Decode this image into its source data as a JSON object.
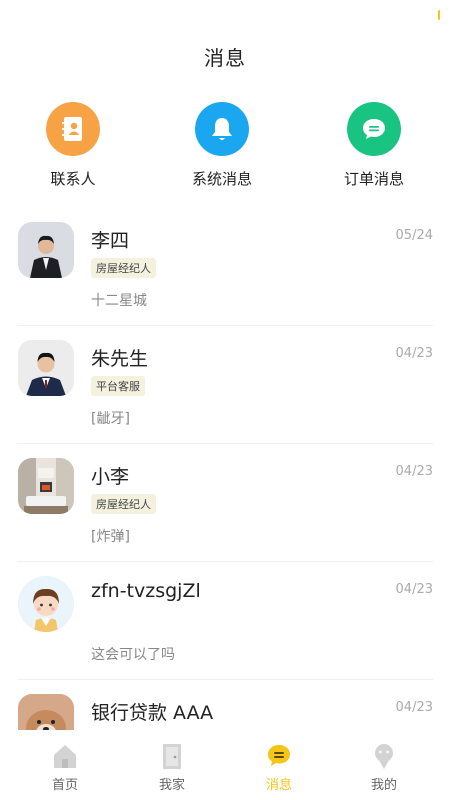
{
  "header": {
    "title": "消息"
  },
  "quick_actions": [
    {
      "label": "联系人",
      "icon": "contacts-book-icon",
      "color": "#F7A245"
    },
    {
      "label": "系统消息",
      "icon": "bell-icon",
      "color": "#1AA7F0"
    },
    {
      "label": "订单消息",
      "icon": "chat-bubble-icon",
      "color": "#19C483"
    }
  ],
  "messages": [
    {
      "name": "李四",
      "date": "05/24",
      "badge": "房屋经纪人",
      "preview": "十二星城"
    },
    {
      "name": "朱先生",
      "date": "04/23",
      "badge": "平台客服",
      "preview": "[龇牙]"
    },
    {
      "name": "小李",
      "date": "04/23",
      "badge": "房屋经纪人",
      "preview": "[炸弹]"
    },
    {
      "name": "zfn-tvzsgjZl",
      "date": "04/23",
      "badge": "",
      "preview": "这会可以了吗"
    },
    {
      "name": "银行贷款 AAA",
      "date": "04/23",
      "badge": "",
      "preview": ""
    }
  ],
  "tabbar": {
    "items": [
      {
        "label": "首页",
        "icon": "house-icon",
        "active": false
      },
      {
        "label": "我家",
        "icon": "door-icon",
        "active": false
      },
      {
        "label": "消息",
        "icon": "message-icon",
        "active": true
      },
      {
        "label": "我的",
        "icon": "person-icon",
        "active": false
      }
    ]
  },
  "colors": {
    "accent": "#F5C518",
    "badge_bg": "#F4F1DF",
    "divider": "#F0F0F0"
  }
}
